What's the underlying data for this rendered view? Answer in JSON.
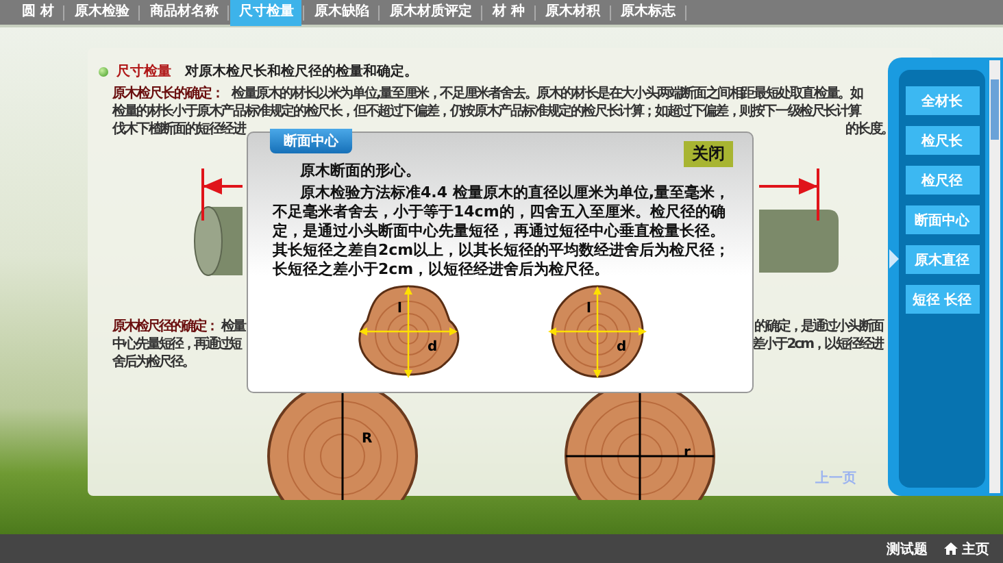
{
  "nav": {
    "tabs": [
      {
        "label": "圆 材",
        "selected": false
      },
      {
        "label": "原木检验",
        "selected": false
      },
      {
        "label": "商品材名称",
        "selected": false
      },
      {
        "label": "尺寸检量",
        "selected": true
      },
      {
        "label": "原木缺陷",
        "selected": false
      },
      {
        "label": "原木材质评定",
        "selected": false
      },
      {
        "label": "材 种",
        "selected": false
      },
      {
        "label": "原木材积",
        "selected": false
      },
      {
        "label": "原木标志",
        "selected": false
      }
    ]
  },
  "content": {
    "heading": {
      "title": "尺寸检量",
      "text": "对原木检尺长和检尺径的检量和确定。"
    },
    "length_section": {
      "label": "原木检尺长的确定：",
      "lines": [
        {
          "left": "检量原木的材长以米为单位,量至厘米，不足厘米者舍去。原木的材长是在大小头两端断面之间相距最短处取直检量。如"
        },
        {
          "left": "检量的材长小于原木产品标准规定的检尺长，但不超过下偏差，仍按原木产品标准规定的检尺长计算；如超过下偏差，则按下一级检尺长计算"
        },
        {
          "left": "伐木下楂断面的短径经进",
          "right": "的长度。"
        }
      ]
    },
    "diameter_section": {
      "label": "原木检尺径的确定：",
      "lines": [
        {
          "left": "检量",
          "right": "的确定，是通过小头断面"
        },
        {
          "left": "中心先量短径，再通过短",
          "right": "差小于2cm，以短径经进"
        },
        {
          "left": "舍后为检尺径。"
        }
      ]
    },
    "cross_sections": [
      {
        "label": "R"
      },
      {
        "label": "r"
      }
    ],
    "pager": {
      "prev": "上一页"
    }
  },
  "side_menu": {
    "buttons": [
      "全材长",
      "检尺长",
      "检尺径",
      "断面中心",
      "原木直径",
      "短径 长径"
    ]
  },
  "dialog": {
    "tab": "断面中心",
    "close": "关闭",
    "title": "原木断面的形心。",
    "body": "原木检验方法标准4.4 检量原木的直径以厘米为单位,量至毫米，不足毫米者舍去，小于等于14cm的，四舍五入至厘米。检尺径的确定，是通过小头断面中心先量短径，再通过短径中心垂直检量长径。其长短径之差自2cm以上，以其长短径的平均数经进舍后为检尺径；长短径之差小于2cm，以短径经进舍后为检尺径。",
    "figures": [
      {
        "kind": "irregular",
        "long_label": "l",
        "short_label": "d"
      },
      {
        "kind": "round",
        "long_label": "l",
        "short_label": "d"
      }
    ]
  },
  "footer": {
    "quiz": "测试题",
    "home": "主页"
  }
}
